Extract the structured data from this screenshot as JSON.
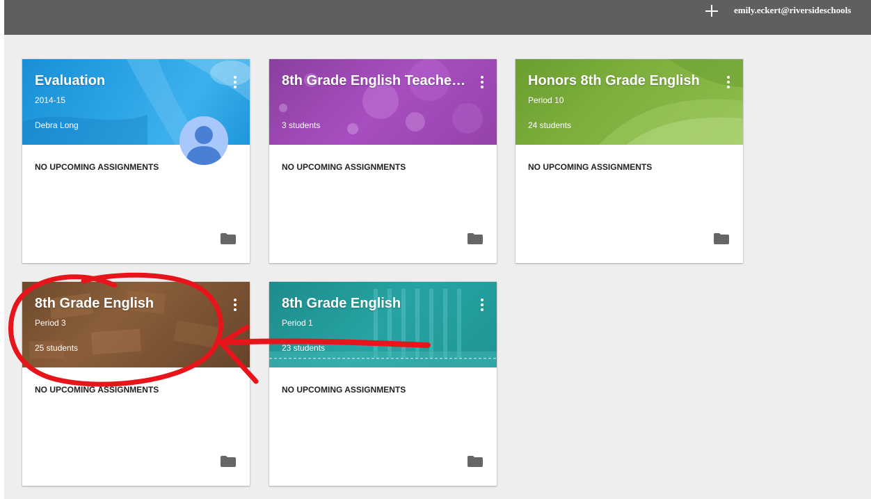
{
  "topbar": {
    "add_icon": "plus-icon",
    "account": "emily.eckert@riversideschools"
  },
  "cards": [
    {
      "title": "Evaluation",
      "subtitle": "2014-15",
      "info": "Debra Long",
      "body": "NO UPCOMING ASSIGNMENTS",
      "header_color": "#1a8fd6"
    },
    {
      "title": "8th Grade English Teache…",
      "subtitle": "",
      "info": "3 students",
      "body": "NO UPCOMING ASSIGNMENTS",
      "header_color": "#a84ec0"
    },
    {
      "title": "Honors 8th Grade English",
      "subtitle": "Period 10",
      "info": "24 students",
      "body": "NO UPCOMING ASSIGNMENTS",
      "header_color": "#7fb03f"
    },
    {
      "title": "8th Grade English",
      "subtitle": "Period 3",
      "info": "25 students",
      "body": "NO UPCOMING ASSIGNMENTS",
      "header_color": "#7a5232"
    },
    {
      "title": "8th Grade English",
      "subtitle": "Period 1",
      "info": "23 students",
      "body": "NO UPCOMING ASSIGNMENTS",
      "header_color": "#27a3a3"
    }
  ],
  "annotation_color": "#e8141c"
}
